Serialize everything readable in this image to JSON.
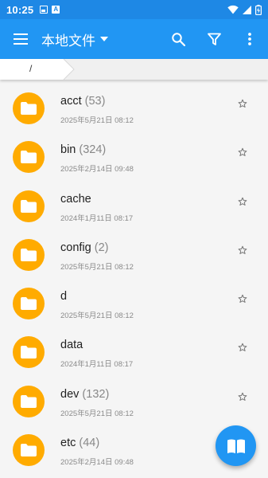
{
  "status_bar": {
    "time": "10:25",
    "icons": [
      "image-icon",
      "a-icon",
      "wifi-icon",
      "signal-icon",
      "battery-icon"
    ]
  },
  "app_bar": {
    "title": "本地文件",
    "actions": [
      "menu-icon",
      "dropdown-icon",
      "search-icon",
      "filter-icon",
      "more-vert-icon"
    ]
  },
  "breadcrumb": {
    "path": "/"
  },
  "files": [
    {
      "name": "acct",
      "count": "(53)",
      "date": "2025年5月21日 08:12"
    },
    {
      "name": "bin",
      "count": "(324)",
      "date": "2025年2月14日 09:48"
    },
    {
      "name": "cache",
      "count": "",
      "date": "2024年1月11日 08:17"
    },
    {
      "name": "config",
      "count": "(2)",
      "date": "2025年5月21日 08:12"
    },
    {
      "name": "d",
      "count": "",
      "date": "2025年5月21日 08:12"
    },
    {
      "name": "data",
      "count": "",
      "date": "2024年1月11日 08:17"
    },
    {
      "name": "dev",
      "count": "(132)",
      "date": "2025年5月21日 08:12"
    },
    {
      "name": "etc",
      "count": "(44)",
      "date": "2025年2月14日 09:48"
    }
  ],
  "fab": {
    "icon": "book-icon"
  },
  "colors": {
    "primary": "#2196f3",
    "status_bar": "#1e88e5",
    "folder": "#ffab00"
  }
}
